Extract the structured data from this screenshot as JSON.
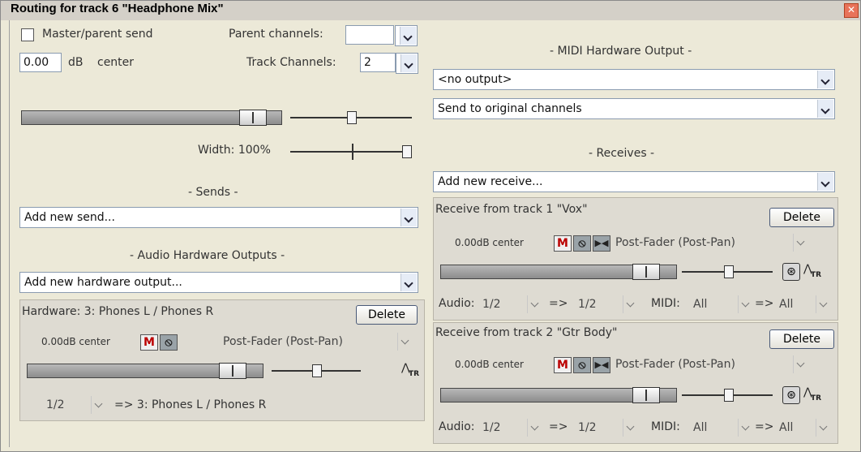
{
  "window": {
    "title": "Routing for track 6 \"Headphone Mix\"",
    "close_glyph": "✕"
  },
  "left": {
    "master_send_label": "Master/parent send",
    "master_send_checked": false,
    "parent_channels_label": "Parent channels:",
    "parent_channels_value": "",
    "volume_value": "0.00",
    "volume_unit_label": "dB",
    "pan_label": "center",
    "track_channels_label": "Track Channels:",
    "track_channels_value": "2",
    "width_label": "Width: 100%",
    "sends_header": "- Sends -",
    "add_send": "Add new send...",
    "hw_outputs_header": "- Audio Hardware Outputs -",
    "add_hw_output": "Add new hardware output...",
    "hardware": {
      "title": "Hardware: 3: Phones L / Phones R",
      "delete_label": "Delete",
      "vol_pan": "0.00dB center",
      "mute_label": "M",
      "phase_label": "⦸",
      "mode": "Post-Fader (Post-Pan)",
      "src_channels": "1/2",
      "dest": "=> 3: Phones L / Phones R",
      "env_icon_label": "TR"
    }
  },
  "right": {
    "midi_hw_header": "- MIDI Hardware Output -",
    "midi_output": "<no output>",
    "midi_channel_mode": "Send to original channels",
    "receives_header": "- Receives -",
    "add_receive": "Add new receive...",
    "receives": [
      {
        "title": "Receive from track 1 \"Vox\"",
        "delete_label": "Delete",
        "vol_pan": "0.00dB center",
        "mute_label": "M",
        "phase_label": "⦸",
        "mono_label": "▶◀",
        "mode": "Post-Fader (Post-Pan)",
        "audio_label": "Audio:",
        "audio_src": "1/2",
        "arrow": "=>",
        "audio_dest": "1/2",
        "midi_label": "MIDI:",
        "midi_src": "All",
        "midi_arrow": "=>",
        "midi_dest": "All",
        "env_icon_label": "TR"
      },
      {
        "title": "Receive from track 2 \"Gtr Body\"",
        "delete_label": "Delete",
        "vol_pan": "0.00dB center",
        "mute_label": "M",
        "phase_label": "⦸",
        "mono_label": "▶◀",
        "mode": "Post-Fader (Post-Pan)",
        "audio_label": "Audio:",
        "audio_src": "1/2",
        "arrow": "=>",
        "audio_dest": "1/2",
        "midi_label": "MIDI:",
        "midi_src": "All",
        "midi_arrow": "=>",
        "midi_dest": "All",
        "env_icon_label": "TR"
      }
    ]
  }
}
